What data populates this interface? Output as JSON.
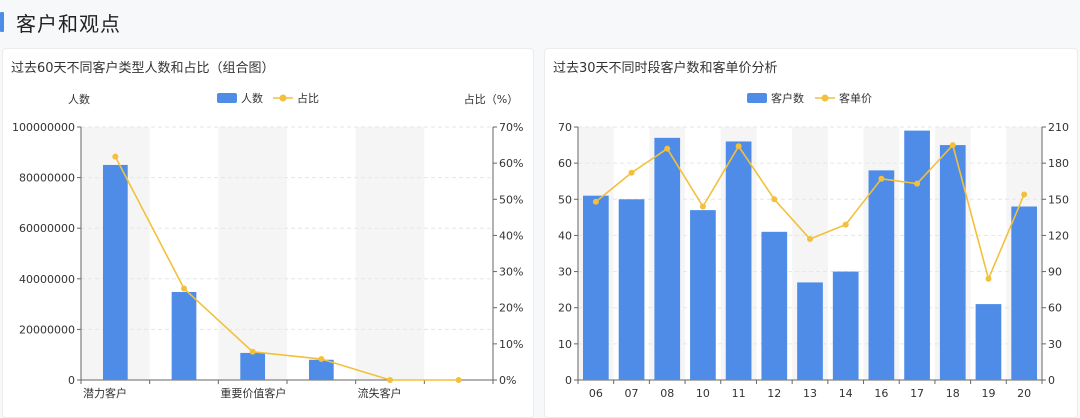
{
  "section": {
    "title": "客户和观点"
  },
  "colors": {
    "bar": "#4e8ce8",
    "line": "#f2c03b",
    "band": "#f5f5f5",
    "grid": "#e6e6e6",
    "axis": "#666666",
    "text": "#333333",
    "accent": "#4e8ce8"
  },
  "chart_data": [
    {
      "type": "bar",
      "title": "过去60天不同客户类型人数和占比（组合图）",
      "categories": [
        "潜力客户",
        "",
        "重要价值客户",
        "",
        "流失客户",
        ""
      ],
      "xtick_labels": [
        "潜力客户",
        "重要价值客户",
        "流失客户"
      ],
      "series": [
        {
          "name": "人数",
          "type": "bar",
          "axis": "left",
          "values": [
            85000000,
            34800000,
            10700000,
            8000000,
            0,
            0
          ]
        },
        {
          "name": "占比",
          "type": "line",
          "axis": "right",
          "values": [
            61.8,
            25.3,
            7.8,
            5.8,
            0,
            0
          ]
        }
      ],
      "ylabel": "人数",
      "ylabel_right": "占比（%）",
      "ylim": [
        0,
        100000000
      ],
      "yticks": [
        "0",
        "20000000",
        "40000000",
        "60000000",
        "80000000",
        "100000000"
      ],
      "ylim_right": [
        0,
        70
      ],
      "yticks_right": [
        "0%",
        "10%",
        "20%",
        "30%",
        "40%",
        "50%",
        "60%",
        "70%"
      ],
      "legend": "top-center",
      "grid": true
    },
    {
      "type": "bar",
      "title": "过去30天不同时段客户数和客单价分析",
      "categories": [
        "06",
        "07",
        "08",
        "10",
        "11",
        "12",
        "13",
        "14",
        "16",
        "17",
        "18",
        "19",
        "20"
      ],
      "series": [
        {
          "name": "客户数",
          "type": "bar",
          "axis": "left",
          "values": [
            51,
            50,
            67,
            47,
            66,
            41,
            27,
            30,
            58,
            69,
            65,
            21,
            48
          ]
        },
        {
          "name": "客单价",
          "type": "line",
          "axis": "right",
          "values": [
            148,
            172,
            192,
            144,
            194,
            150,
            117,
            129,
            167,
            163,
            195,
            84,
            154
          ]
        }
      ],
      "ylim": [
        0,
        70
      ],
      "yticks": [
        "0",
        "10",
        "20",
        "30",
        "40",
        "50",
        "60",
        "70"
      ],
      "ylim_right": [
        0,
        210
      ],
      "yticks_right": [
        "0",
        "30",
        "60",
        "90",
        "120",
        "150",
        "180",
        "210"
      ],
      "legend": "top-center",
      "grid": true
    }
  ]
}
